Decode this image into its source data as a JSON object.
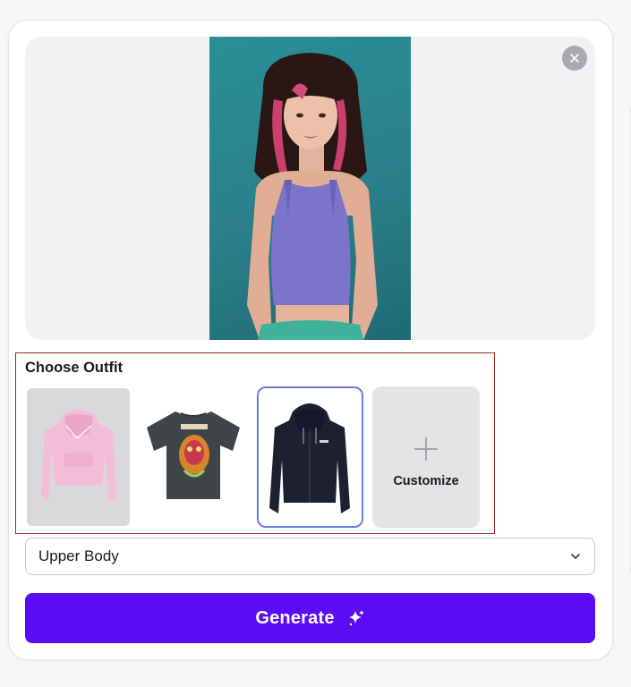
{
  "preview": {
    "close_icon": "close-icon"
  },
  "outfit": {
    "title": "Choose Outfit",
    "items": [
      {
        "name": "pink-hoodie",
        "color": "#f3bcd7"
      },
      {
        "name": "graphic-tshirt",
        "color": "#3f4449"
      },
      {
        "name": "black-zip-hoodie",
        "color": "#1d2030",
        "selected": true
      }
    ],
    "customize_label": "Customize",
    "customize_icon": "plus-icon"
  },
  "body_select": {
    "value": "Upper Body",
    "icon": "chevron-down-icon"
  },
  "generate": {
    "label": "Generate",
    "icon": "sparkle-icon",
    "color": "#5b0cf5"
  },
  "colors": {
    "selected_border": "#6c7ae0",
    "highlight_box": "#9b2b2b"
  }
}
